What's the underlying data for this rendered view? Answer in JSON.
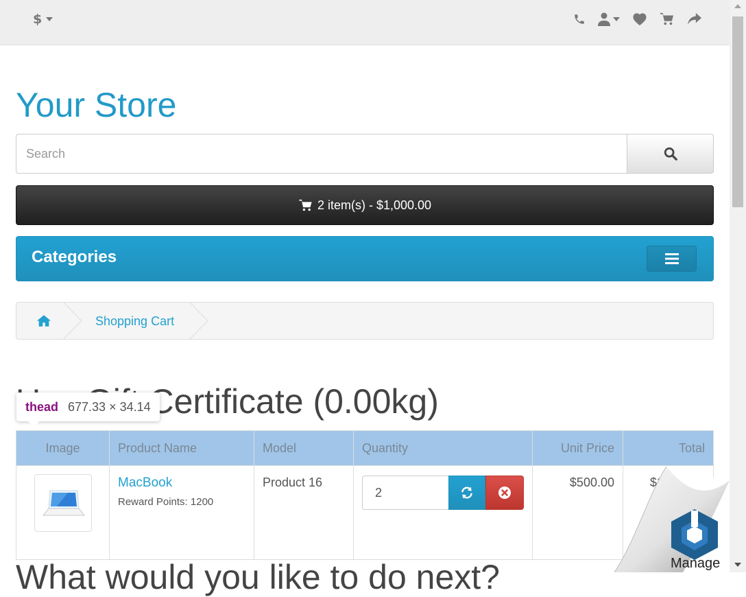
{
  "topbar": {
    "currency_symbol": "$",
    "icons": [
      "phone-icon",
      "user-icon",
      "heart-icon",
      "cart-icon",
      "share-icon"
    ]
  },
  "logo": {
    "text": "Your Store"
  },
  "search": {
    "placeholder": "Search"
  },
  "cart_button": {
    "label": "2 item(s) - $1,000.00"
  },
  "categories": {
    "title": "Categories"
  },
  "breadcrumb": {
    "current": "Shopping Cart"
  },
  "page": {
    "heading": "Use Gift Certificate  (0.00kg)",
    "heading_visible": "Certificate  (0.00kg)",
    "next_heading": "What would you like to do next?"
  },
  "tooltip": {
    "tag": "thead",
    "size": "677.33 × 34.14"
  },
  "table": {
    "headers": {
      "image": "Image",
      "name": "Product Name",
      "model": "Model",
      "quantity": "Quantity",
      "unit_price": "Unit Price",
      "total": "Total"
    },
    "rows": [
      {
        "name": "MacBook",
        "reward": "Reward Points: 1200",
        "model": "Product 16",
        "quantity": "2",
        "unit_price": "$500.00",
        "total": "$1,000.00"
      }
    ]
  },
  "manage": {
    "label": "Manage"
  },
  "colors": {
    "accent": "#229ac8",
    "header_row": "#a0c5e8",
    "danger": "#da4f49",
    "cart_dark": "#303030"
  }
}
